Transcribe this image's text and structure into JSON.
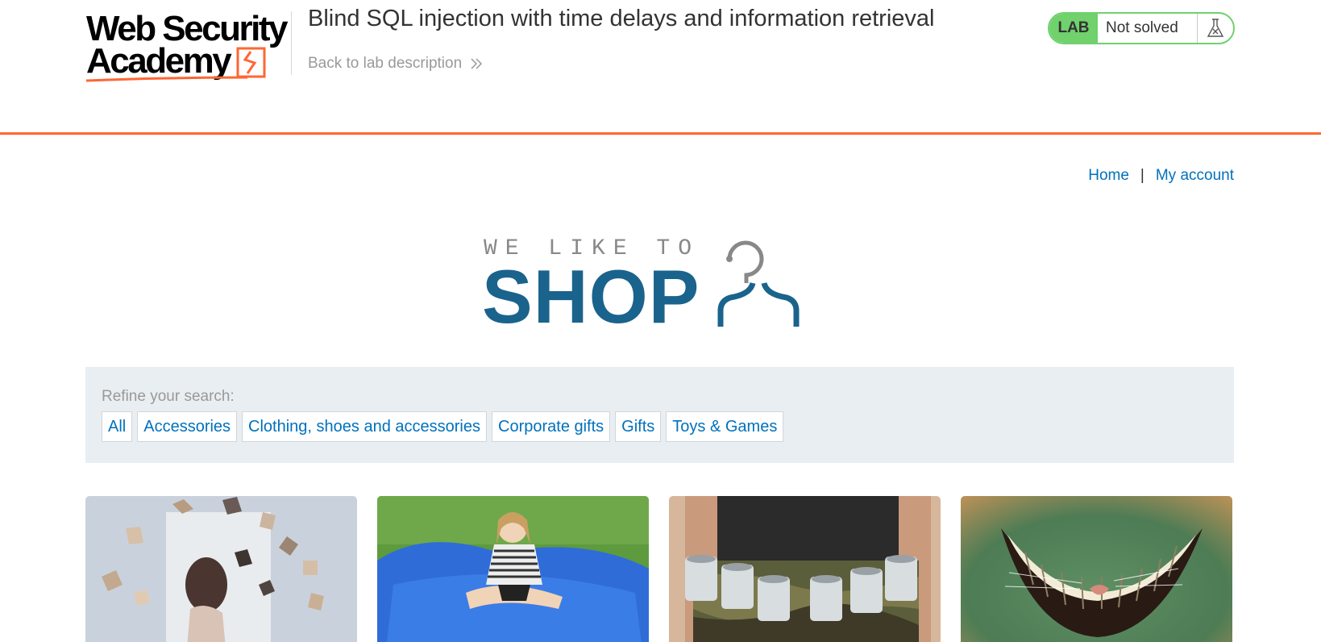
{
  "academy": {
    "logo_line1": "Web Security",
    "logo_line2": "Academy",
    "lab_title": "Blind SQL injection with time delays and information retrieval",
    "back_link": "Back to lab description",
    "status_badge": "LAB",
    "status_text": "Not solved",
    "status_icon": "flask-icon",
    "accent_color": "#ff6633",
    "status_color": "#70d16d"
  },
  "nav": {
    "home": "Home",
    "separator": "|",
    "my_account": "My account",
    "link_color": "#0071bc"
  },
  "banner": {
    "tagline": "WE LIKE TO",
    "word": "SHOP",
    "icon": "hanger-icon",
    "color": "#1a638c"
  },
  "filter": {
    "label": "Refine your search:",
    "categories": [
      "All",
      "Accessories",
      "Clothing, shoes and accessories",
      "Corporate gifts",
      "Gifts",
      "Toys & Games"
    ]
  },
  "products": [
    {
      "image": "flying-books-image"
    },
    {
      "image": "giant-beanbag-image"
    },
    {
      "image": "beer-belt-image"
    },
    {
      "image": "grin-image"
    }
  ]
}
